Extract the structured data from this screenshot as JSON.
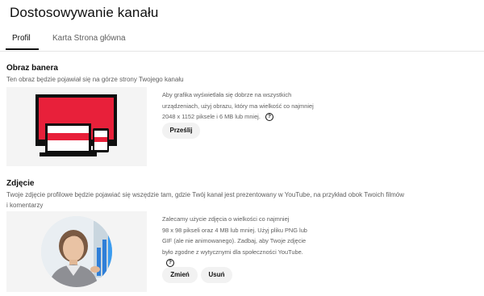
{
  "page": {
    "title": "Dostosowywanie kanału"
  },
  "tabs": [
    {
      "label": "Profil",
      "active": true
    },
    {
      "label": "Karta Strona główna",
      "active": false
    }
  ],
  "banner": {
    "title": "Obraz banera",
    "description": "Ten obraz będzie pojawiał się na górze strony Twojego kanału",
    "hint_lines": [
      "Aby grafika wyświetlała się dobrze na wszystkich",
      "urządzeniach, użyj obrazu, który ma wielkość co najmniej",
      "2048 x 1152 piksele i 6 MB lub mniej."
    ],
    "help_icon": "?",
    "upload_label": "Prześlij"
  },
  "photo": {
    "title": "Zdjęcie",
    "description_lines": [
      "Twoje zdjęcie profilowe będzie pojawiać się wszędzie tam, gdzie Twój kanał jest prezentowany w YouTube, na przykład obok Twoich filmów",
      "i komentarzy"
    ],
    "hint_lines": [
      "Zalecamy użycie zdjęcia o wielkości co najmniej",
      "98 x 98 pikseli oraz 4 MB lub mniej. Użyj pliku PNG lub",
      "GIF (ale nie animowanego). Zadbaj, aby Twoje zdjęcie",
      "było zgodne z wytycznymi dla społeczności YouTube."
    ],
    "help_icon": "?",
    "change_label": "Zmień",
    "remove_label": "Usuń"
  },
  "colors": {
    "banner_red": "#e8203a",
    "banner_black": "#0f0f0f",
    "button_bg": "#f2f2f2",
    "panel_bg": "#f4f4f4"
  }
}
